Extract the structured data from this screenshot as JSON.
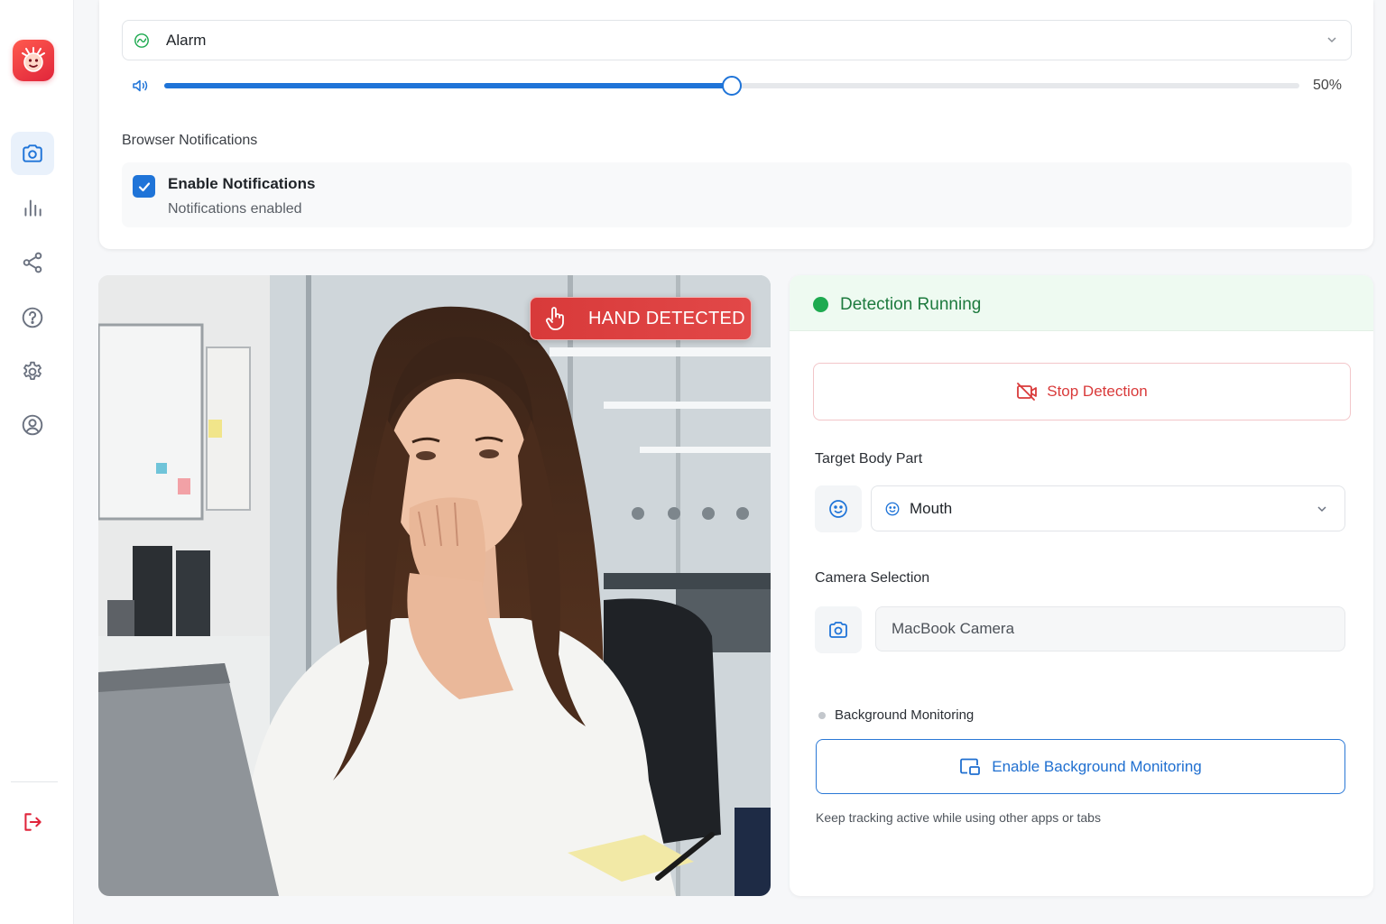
{
  "app": {
    "logo_icon": "alarm-clown-logo-icon",
    "brand_color": "#e0253b",
    "accent_color": "#1f74d8"
  },
  "sidebar": {
    "items": [
      {
        "name": "camera",
        "icon": "camera-icon",
        "active": true
      },
      {
        "name": "statistics",
        "icon": "bar-chart-icon",
        "active": false
      },
      {
        "name": "share",
        "icon": "share-icon",
        "active": false
      },
      {
        "name": "help",
        "icon": "help-icon",
        "active": false
      },
      {
        "name": "settings",
        "icon": "gear-icon",
        "active": false
      },
      {
        "name": "profile",
        "icon": "user-icon",
        "active": false
      }
    ],
    "logout_icon": "logout-icon"
  },
  "settings": {
    "sound_select": {
      "value": "Alarm",
      "icon": "alarm-icon"
    },
    "volume": {
      "value": 0.5,
      "label": "50%"
    },
    "notifications": {
      "heading": "Browser Notifications",
      "checkbox_checked": true,
      "title": "Enable Notifications",
      "status": "Notifications enabled"
    }
  },
  "camera": {
    "badge": "HAND DETECTED",
    "badge_icon": "hand-pointer-icon",
    "badge_color": "#d83a3a"
  },
  "panel": {
    "status": "Detection Running",
    "status_color": "#1eaa50",
    "stop_button": "Stop Detection",
    "target_label": "Target Body Part",
    "target_value": "Mouth",
    "camera_label": "Camera Selection",
    "camera_value": "MacBook Camera",
    "bg_label": "Background Monitoring",
    "bg_button": "Enable Background Monitoring",
    "bg_note": "Keep tracking active while using other apps or tabs"
  }
}
